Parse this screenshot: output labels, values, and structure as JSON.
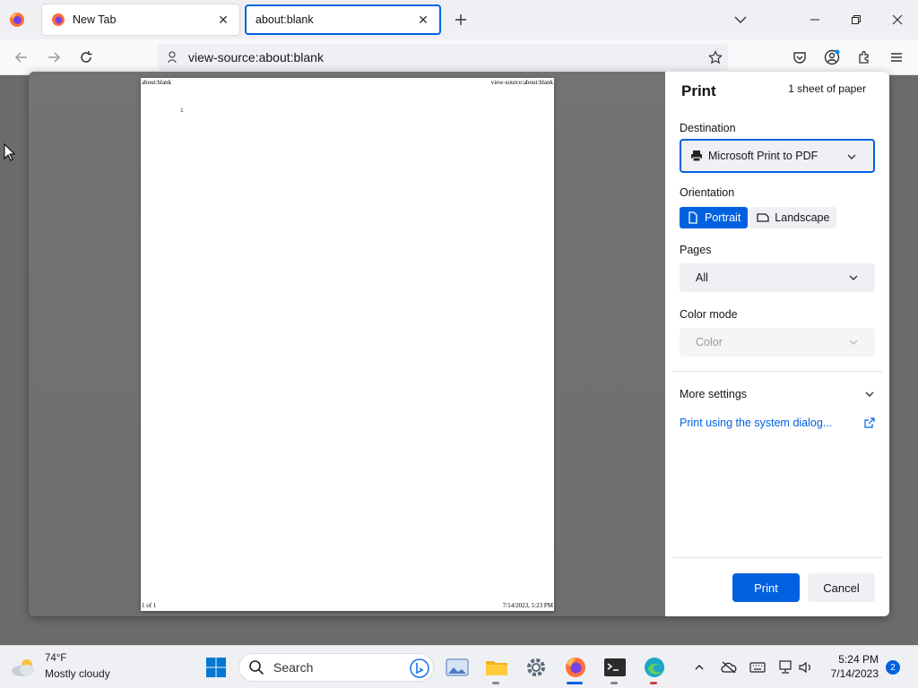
{
  "browser": {
    "tabs": [
      {
        "title": "New Tab"
      },
      {
        "title": "about:blank"
      }
    ],
    "url": "view-source:about:blank"
  },
  "print": {
    "title": "Print",
    "sheets": "1 sheet of paper",
    "destination_label": "Destination",
    "destination_value": "Microsoft Print to PDF",
    "orientation_label": "Orientation",
    "portrait": "Portrait",
    "landscape": "Landscape",
    "pages_label": "Pages",
    "pages_value": "All",
    "color_label": "Color mode",
    "color_value": "Color",
    "more_settings": "More settings",
    "system_dialog": "Print using the system dialog...",
    "print_button": "Print",
    "cancel_button": "Cancel"
  },
  "preview": {
    "header_left": "about:blank",
    "header_right": "view-source:about:blank",
    "line_number": "1",
    "footer_left": "1 of 1",
    "footer_right": "7/14/2023, 5:23 PM"
  },
  "taskbar": {
    "temperature": "74°F",
    "weather": "Mostly cloudy",
    "search_placeholder": "Search",
    "time": "5:24 PM",
    "date": "7/14/2023",
    "notifications": "2"
  }
}
